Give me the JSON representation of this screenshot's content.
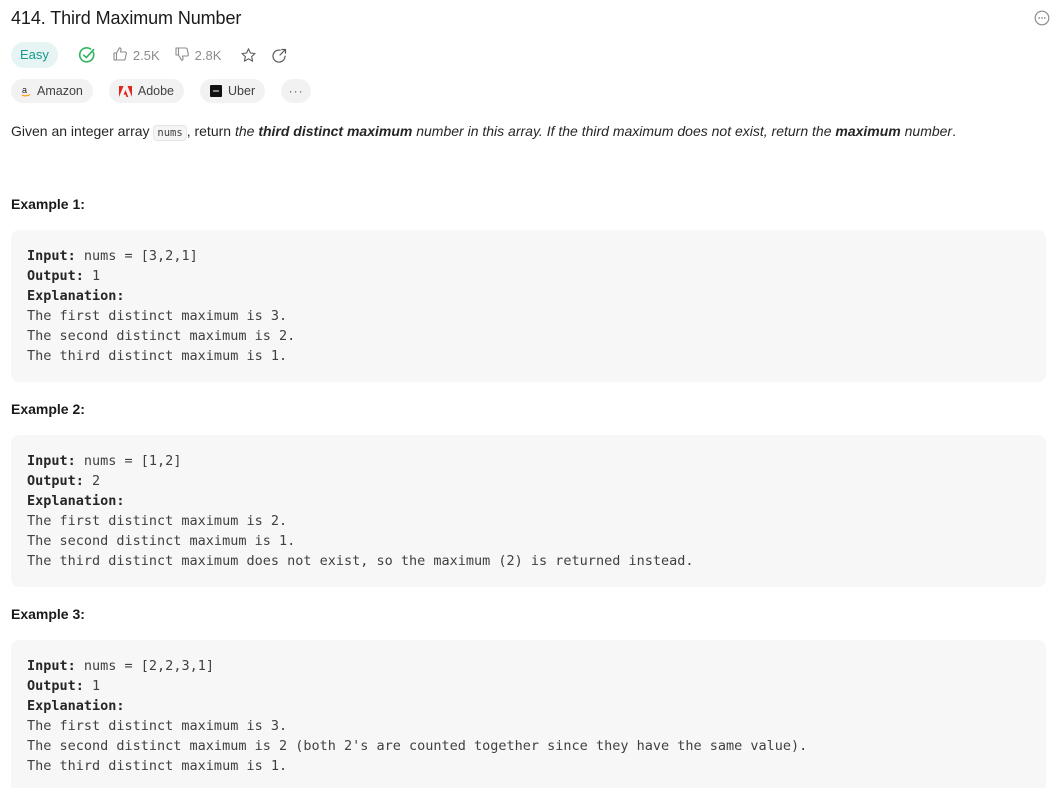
{
  "problem": {
    "title": "414. Third Maximum Number",
    "difficulty": "Easy",
    "likes": "2.5K",
    "dislikes": "2.8K"
  },
  "tags": [
    {
      "label": "Amazon",
      "logo": "amazon-logo"
    },
    {
      "label": "Adobe",
      "logo": "adobe-logo"
    },
    {
      "label": "Uber",
      "logo": "uber-logo"
    },
    {
      "label": "···"
    }
  ],
  "description": {
    "p1": "Given an integer array ",
    "code": "nums",
    "p2": ", return ",
    "i1": "the ",
    "b1": "third distinct maximum",
    "i2": " number in this array. If the third maximum does not exist, return the ",
    "b2": "maximum",
    "i3": " number",
    "p3": "."
  },
  "labels": {
    "input": "Input:",
    "output": "Output:",
    "explanation": "Explanation:"
  },
  "examples": [
    {
      "title": "Example 1:",
      "input": " nums = [3,2,1]",
      "output": " 1",
      "lines": [
        "The first distinct maximum is 3.",
        "The second distinct maximum is 2.",
        "The third distinct maximum is 1."
      ]
    },
    {
      "title": "Example 2:",
      "input": " nums = [1,2]",
      "output": " 2",
      "lines": [
        "The first distinct maximum is 2.",
        "The second distinct maximum is 1.",
        "The third distinct maximum does not exist, so the maximum (2) is returned instead."
      ]
    },
    {
      "title": "Example 3:",
      "input": " nums = [2,2,3,1]",
      "output": " 1",
      "lines": [
        "The first distinct maximum is 3.",
        "The second distinct maximum is 2 (both 2's are counted together since they have the same value).",
        "The third distinct maximum is 1."
      ]
    }
  ],
  "colors": {
    "easy": "#159a8c",
    "solved": "#2db55d",
    "adobe": "#e1251b",
    "amazon": "#ff9900"
  }
}
